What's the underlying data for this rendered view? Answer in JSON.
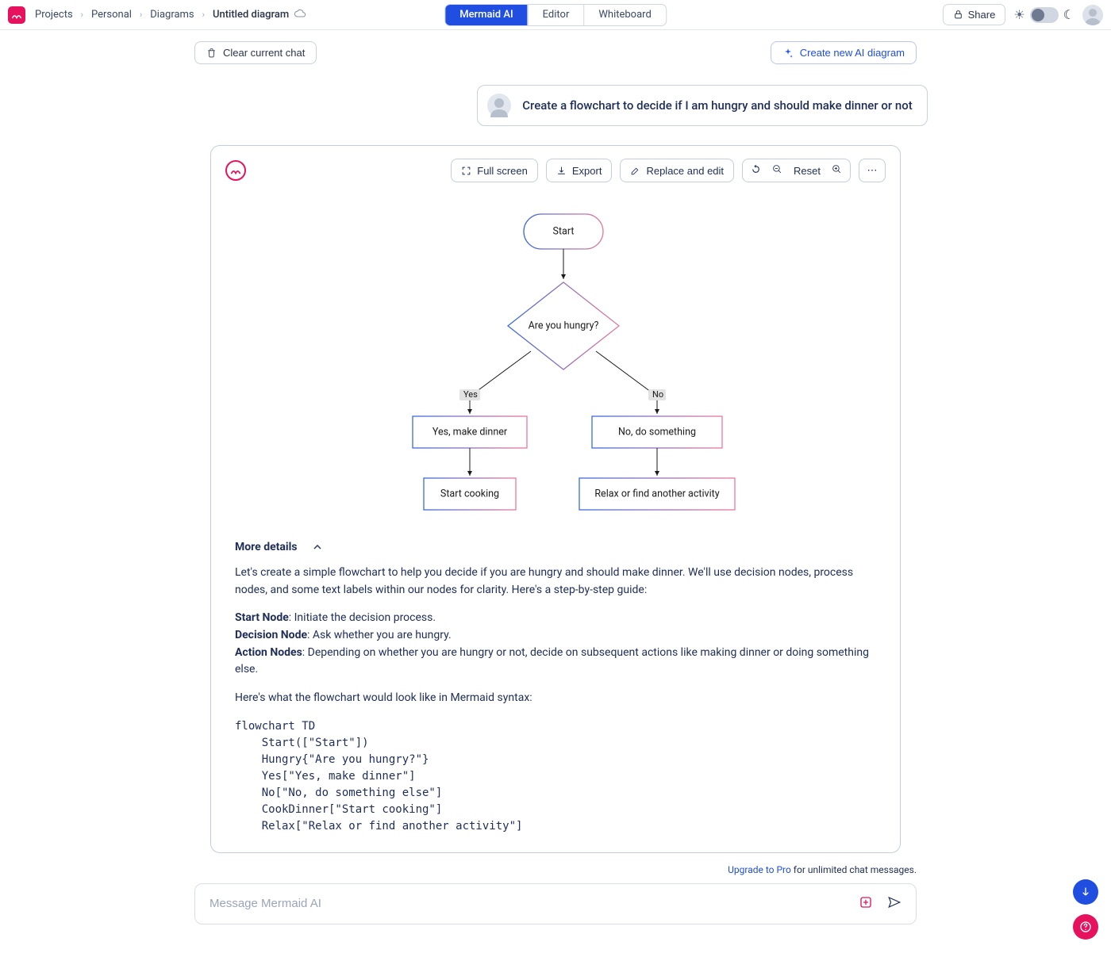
{
  "breadcrumbs": {
    "items": [
      "Projects",
      "Personal",
      "Diagrams"
    ],
    "title": "Untitled diagram"
  },
  "tabs": {
    "mermaid": "Mermaid AI",
    "editor": "Editor",
    "whiteboard": "Whiteboard"
  },
  "share_label": "Share",
  "clear_chat_label": "Clear current chat",
  "create_new_label": "Create new AI diagram",
  "user_prompt": "Create a flowchart to decide if I am hungry and should make dinner or not",
  "toolbar": {
    "fullscreen": "Full screen",
    "export": "Export",
    "replace": "Replace and edit",
    "reset": "Reset"
  },
  "flowchart": {
    "nodes": {
      "start": "Start",
      "decision": "Are you hungry?",
      "yes_action": "Yes, make dinner",
      "no_action": "No, do something",
      "cook": "Start cooking",
      "relax": "Relax or find another activity"
    },
    "edges": {
      "yes": "Yes",
      "no": "No"
    }
  },
  "details": {
    "header": "More details",
    "intro": "Let's create a simple flowchart to help you decide if you are hungry and should make dinner. We'll use decision nodes, process nodes, and some text labels within our nodes for clarity. Here's a step-by-step guide:",
    "start_label": "Start Node",
    "start_text": ": Initiate the decision process.",
    "decision_label": "Decision Node",
    "decision_text": ": Ask whether you are hungry.",
    "action_label": "Action Nodes",
    "action_text": ": Depending on whether you are hungry or not, decide on subsequent actions like making dinner or doing something else.",
    "syntax_intro": "Here's what the flowchart would look like in Mermaid syntax:",
    "code": "flowchart TD\n    Start([\"Start\"])\n    Hungry{\"Are you hungry?\"}\n    Yes[\"Yes, make dinner\"]\n    No[\"No, do something else\"]\n    CookDinner[\"Start cooking\"]\n    Relax[\"Relax or find another activity\"]"
  },
  "upgrade": {
    "link": "Upgrade to Pro",
    "text": " for unlimited chat messages."
  },
  "input_placeholder": "Message Mermaid AI"
}
